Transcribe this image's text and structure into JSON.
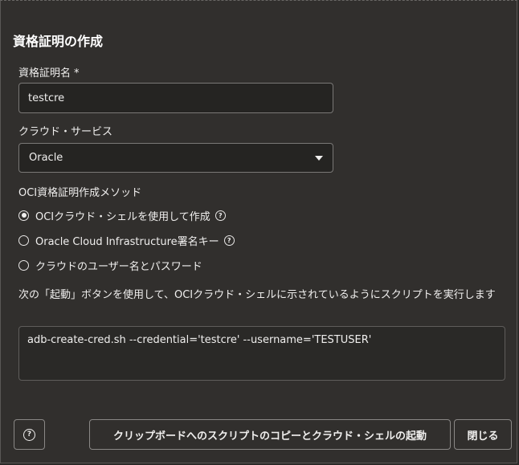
{
  "dialog": {
    "title": "資格証明の作成"
  },
  "credential_name": {
    "label": "資格証明名",
    "required_marker": "*",
    "value": "testcre"
  },
  "cloud_service": {
    "label": "クラウド・サービス",
    "selected": "Oracle"
  },
  "method": {
    "label": "OCI資格証明作成メソッド",
    "options": [
      {
        "label": "OCIクラウド・シェルを使用して作成",
        "checked": true,
        "help_icon": true
      },
      {
        "label": "Oracle Cloud Infrastructure署名キー",
        "checked": false,
        "help_icon": true
      },
      {
        "label": "クラウドのユーザー名とパスワード",
        "checked": false,
        "help_icon": false
      }
    ]
  },
  "instruction": "次の「起動」ボタンを使用して、OCIクラウド・シェルに示されているようにスクリプトを実行します",
  "script": "adb-create-cred.sh --credential='testcre' --username='TESTUSER'",
  "footer": {
    "help_glyph": "?",
    "launch_label": "クリップボードへのスクリプトのコピーとクラウド・シェルの起動",
    "close_label": "閉じる"
  },
  "icons": {
    "help": "question-circle-icon",
    "dropdown": "caret-down-icon"
  }
}
